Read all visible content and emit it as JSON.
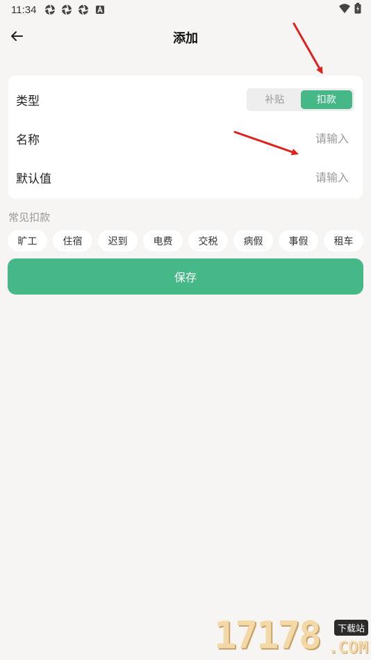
{
  "status_bar": {
    "time": "11:34",
    "icons": [
      "aperture-icon",
      "aperture-icon",
      "aperture-icon",
      "a-box-icon"
    ],
    "right_icons": [
      "wifi-icon",
      "battery-icon"
    ]
  },
  "header": {
    "title": "添加",
    "back_icon": "arrow-left-icon"
  },
  "form": {
    "type": {
      "label": "类型",
      "options": [
        "补贴",
        "扣款"
      ],
      "selected": "扣款"
    },
    "name": {
      "label": "名称",
      "placeholder": "请输入",
      "value": ""
    },
    "default_value": {
      "label": "默认值",
      "placeholder": "请输入",
      "value": ""
    }
  },
  "common_deductions": {
    "title": "常见扣款",
    "items": [
      "旷工",
      "住宿",
      "迟到",
      "电费",
      "交税",
      "病假",
      "事假",
      "租车"
    ]
  },
  "save_label": "保存",
  "watermark": {
    "number": "17178",
    "badge": "下载站",
    "suffix": ".COM"
  },
  "colors": {
    "accent": "#46b887",
    "background": "#f6f5f3",
    "card": "#ffffff",
    "annotation_arrow": "#e0201c"
  }
}
